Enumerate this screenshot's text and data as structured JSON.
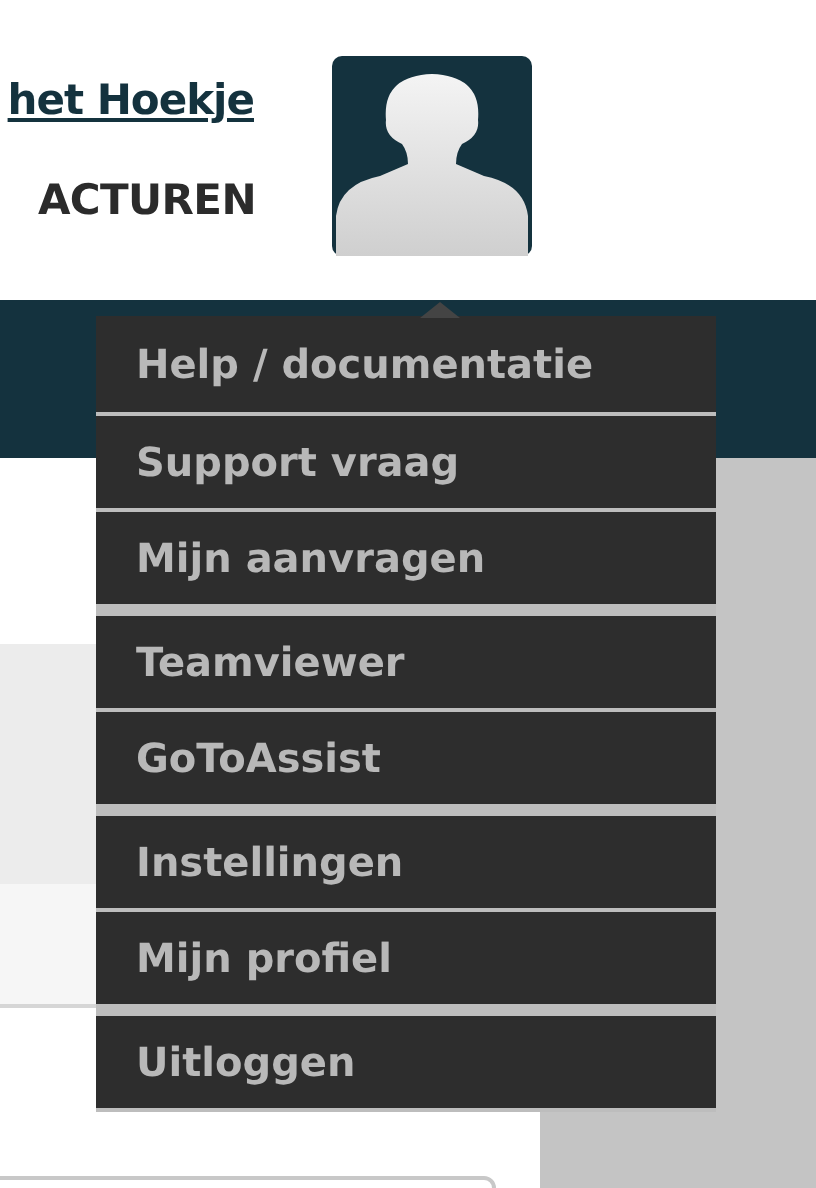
{
  "header": {
    "link": "het Hoekje",
    "section": "ACTUREN"
  },
  "user_menu": {
    "groups": [
      {
        "items": [
          "Help / documentatie",
          "Support vraag",
          "Mijn aanvragen"
        ]
      },
      {
        "items": [
          "Teamviewer",
          "GoToAssist"
        ]
      },
      {
        "items": [
          "Instellingen",
          "Mijn profiel"
        ]
      },
      {
        "items": [
          "Uitloggen"
        ]
      }
    ]
  }
}
